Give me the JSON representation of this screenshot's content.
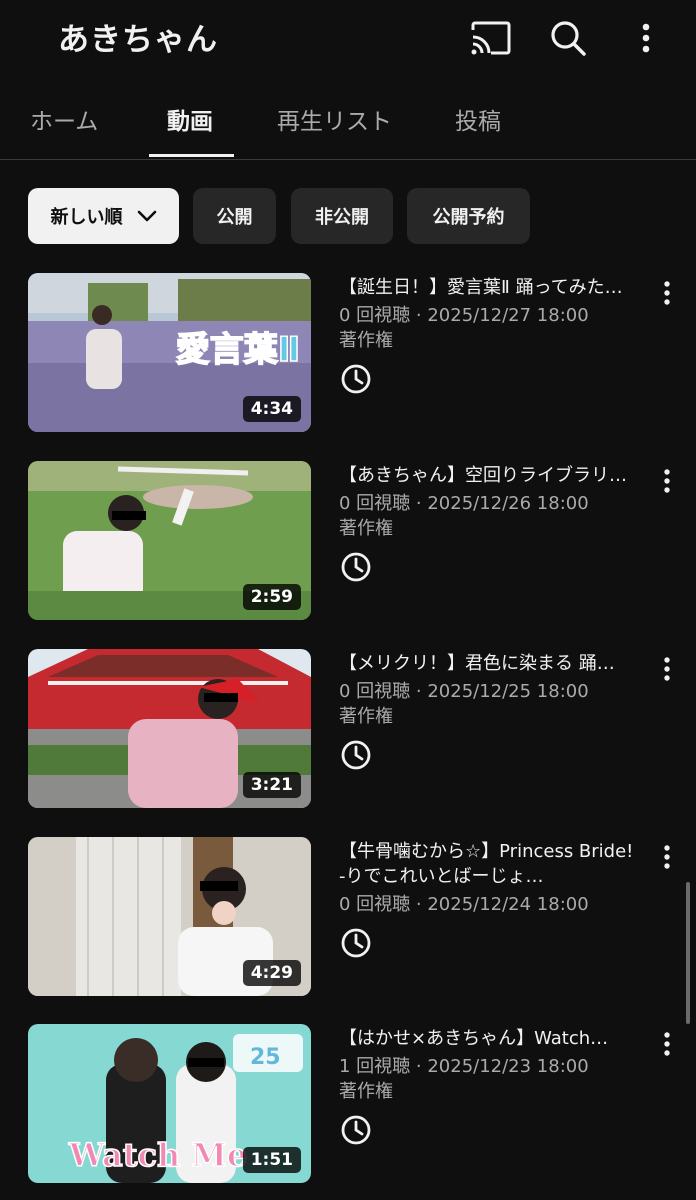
{
  "header": {
    "channel_title": "あきちゃん",
    "icons": [
      "cast-icon",
      "search-icon",
      "more-vert-icon"
    ]
  },
  "tabs": [
    {
      "label": "ホーム",
      "active": false
    },
    {
      "label": "動画",
      "active": true
    },
    {
      "label": "再生リスト",
      "active": false
    },
    {
      "label": "投稿",
      "active": false
    }
  ],
  "filters": [
    {
      "label": "新しい順",
      "selected": true,
      "dropdown": true
    },
    {
      "label": "公開",
      "selected": false
    },
    {
      "label": "非公開",
      "selected": false
    },
    {
      "label": "公開予約",
      "selected": false
    }
  ],
  "videos": [
    {
      "title": "【誕生日！】愛言葉Ⅱ 踊ってみた…",
      "meta": "0 回視聴 · 2025/12/27 18:00",
      "rights": "著作権",
      "duration": "4:34",
      "thumb_text": "愛言葉Ⅱ"
    },
    {
      "title": "【あきちゃん】空回りライブラリ…",
      "meta": "0 回視聴 · 2025/12/26 18:00",
      "rights": "著作権",
      "duration": "2:59"
    },
    {
      "title": "【メリクリ！】君色に染まる 踊…",
      "meta": "0 回視聴 · 2025/12/25 18:00",
      "rights": "著作権",
      "duration": "3:21"
    },
    {
      "title": "【牛骨噛むから☆】Princess Bride! -りでこれいとばーじょ…",
      "meta": "0 回視聴 · 2025/12/24 18:00",
      "rights": "",
      "duration": "4:29"
    },
    {
      "title": "【はかせ×あきちゃん】Watch…",
      "meta": "1 回視聴 · 2025/12/23 18:00",
      "rights": "著作権",
      "duration": "1:51",
      "thumb_text": "Watch Me",
      "thumb_badge": "25"
    }
  ],
  "colors": {
    "background": "#0f0f0f",
    "chip": "#272727",
    "chip_selected": "#f1f1f1",
    "text_primary": "#f1f1f1",
    "text_secondary": "#aaaaaa"
  }
}
